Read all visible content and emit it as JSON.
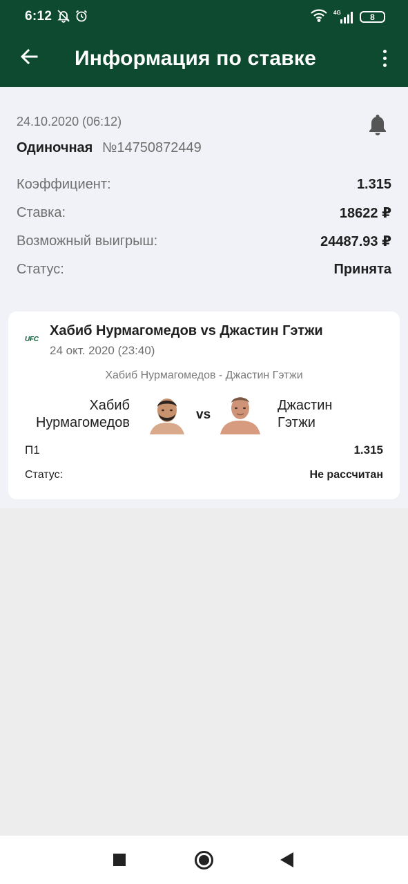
{
  "status_bar": {
    "time": "6:12",
    "network": "4G",
    "battery": "8",
    "icons": [
      "bell-off-icon",
      "alarm-icon",
      "wifi-icon",
      "signal-icon",
      "battery-icon"
    ]
  },
  "app_bar": {
    "title": "Информация по ставке",
    "back_icon": "arrow-left-icon",
    "menu_icon": "more-vert-icon",
    "background": "#0e4a2f"
  },
  "bet": {
    "date": "24.10.2020 (06:12)",
    "type": "Одиночная",
    "number": "№14750872449",
    "rows": [
      {
        "label": "Коэффициент:",
        "value": "1.315"
      },
      {
        "label": "Ставка:",
        "value": "18622 ₽"
      },
      {
        "label": "Возможный выигрыш:",
        "value": "24487.93 ₽"
      },
      {
        "label": "Статус:",
        "value": "Принята"
      }
    ]
  },
  "event": {
    "league": "UFC",
    "title": "Хабиб Нурмагомедов vs Джастин Гэтжи",
    "date": "24 окт. 2020 (23:40)",
    "matchup": "Хабиб Нурмагомедов - Джастин Гэтжи",
    "fighter1": {
      "name_line1": "Хабиб",
      "name_line2": "Нурмагомедов"
    },
    "fighter2": {
      "name_line1": "Джастин",
      "name_line2": "Гэтжи"
    },
    "vs": "vs",
    "outcome": {
      "label": "П1",
      "value": "1.315"
    },
    "status": {
      "label": "Статус:",
      "value": "Не рассчитан"
    }
  },
  "nav": {
    "icons": [
      "recents-square-icon",
      "home-circle-icon",
      "back-triangle-icon"
    ]
  }
}
